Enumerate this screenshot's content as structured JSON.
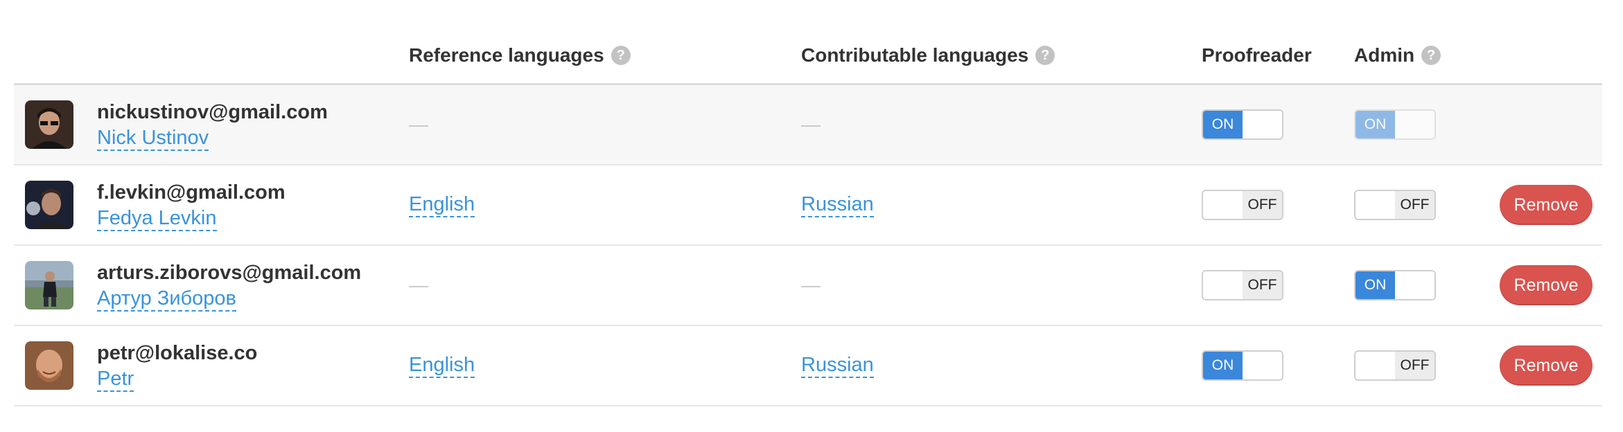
{
  "header": {
    "reference_languages": "Reference languages",
    "contributable_languages": "Contributable languages",
    "proofreader": "Proofreader",
    "admin": "Admin",
    "help_glyph": "?"
  },
  "rows": [
    {
      "email": "nickustinov@gmail.com",
      "name": "Nick Ustinov",
      "reference": "—",
      "contributable": "—",
      "proofreader": "ON",
      "admin": "ON",
      "remove_label": ""
    },
    {
      "email": "f.levkin@gmail.com",
      "name": "Fedya Levkin",
      "reference": "English",
      "contributable": "Russian",
      "proofreader": "OFF",
      "admin": "OFF",
      "remove_label": "Remove"
    },
    {
      "email": "arturs.ziborovs@gmail.com",
      "name": "Артур Зиборов",
      "reference": "—",
      "contributable": "—",
      "proofreader": "OFF",
      "admin": "ON",
      "remove_label": "Remove"
    },
    {
      "email": "petr@lokalise.co",
      "name": "Petr",
      "reference": "English",
      "contributable": "Russian",
      "proofreader": "ON",
      "admin": "OFF",
      "remove_label": "Remove"
    }
  ],
  "colors": {
    "accent": "#3a87db",
    "link": "#3a93db",
    "danger": "#d9534f"
  }
}
